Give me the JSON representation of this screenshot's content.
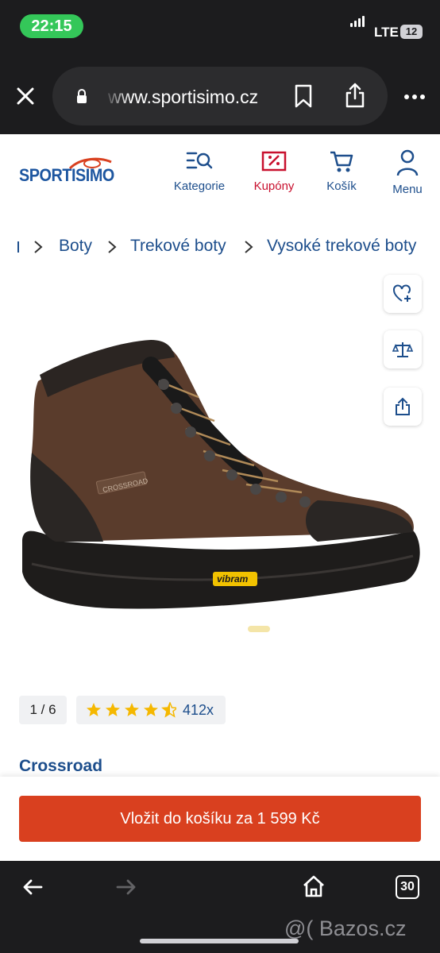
{
  "status": {
    "time": "22:15",
    "network": "LTE",
    "battery": "12"
  },
  "browser": {
    "url": "www.sportisimo.cz",
    "tab_count": "30",
    "watermark": "@( Bazos.cz"
  },
  "header": {
    "logo_text": "SPORTISIMO",
    "nav": [
      {
        "label": "Kategorie",
        "icon": "category-search-icon"
      },
      {
        "label": "Kupóny",
        "icon": "coupon-icon"
      },
      {
        "label": "Košík",
        "icon": "cart-icon"
      },
      {
        "label": "Menu",
        "icon": "user-icon"
      }
    ]
  },
  "breadcrumb": [
    "Boty",
    "Trekové boty",
    "Vysoké trekové boty"
  ],
  "product": {
    "image_position": "1 / 6",
    "rating": 4.5,
    "rating_count": "412x",
    "brand": "Crossroad",
    "add_to_cart": "Vložit do košíku za 1 599 Kč",
    "boot_brand_marks": [
      "vibram",
      "CROSSROAD"
    ]
  },
  "colors": {
    "accent": "#d9401f",
    "brand_blue": "#1d4e8c",
    "coupon_red": "#c8102e",
    "star": "#f5b800"
  }
}
